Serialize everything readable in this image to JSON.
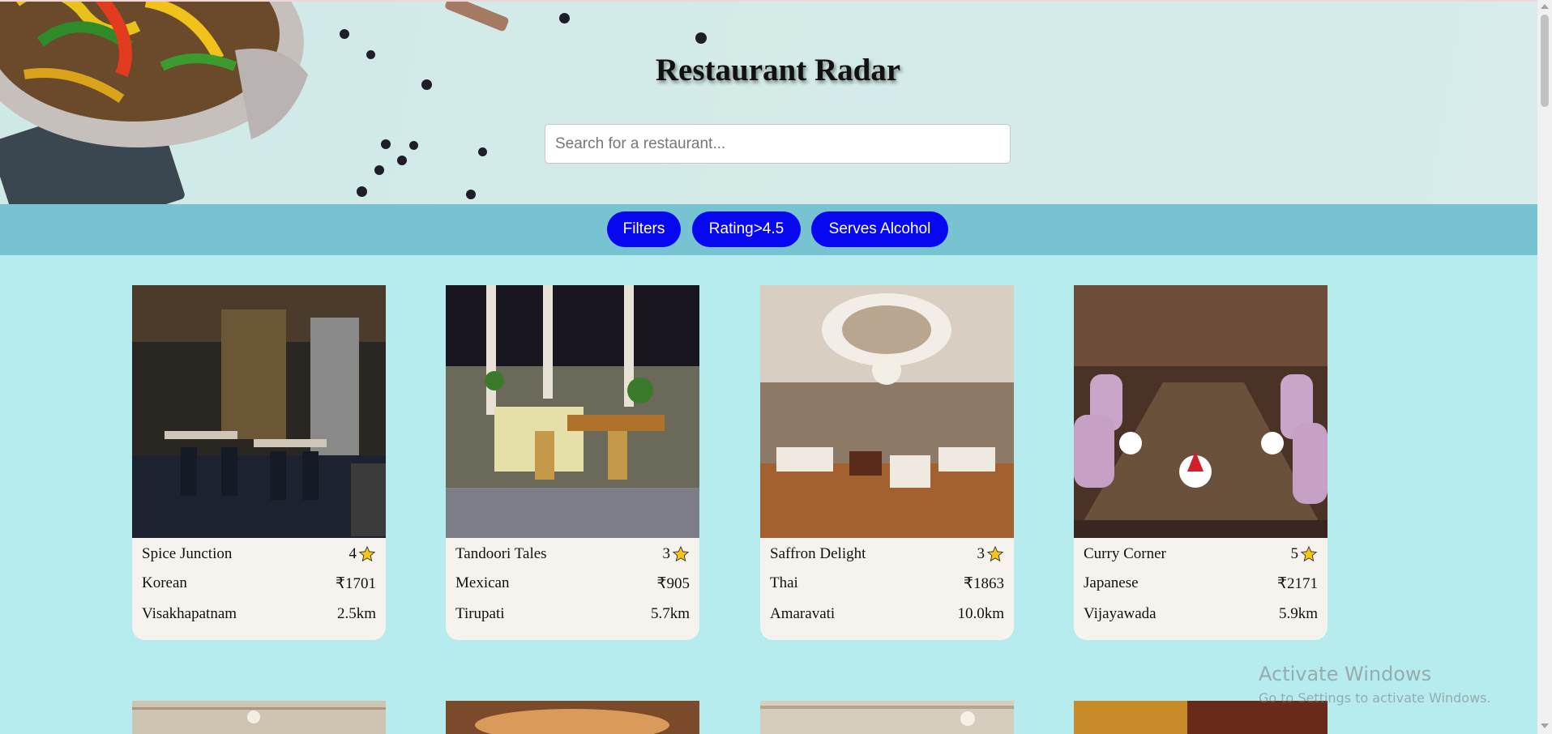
{
  "header": {
    "title": "Restaurant Radar",
    "search_placeholder": "Search for a restaurant..."
  },
  "filters": [
    {
      "label": "Filters"
    },
    {
      "label": "Rating>4.5"
    },
    {
      "label": "Serves Alcohol"
    }
  ],
  "restaurants": [
    {
      "name": "Spice Junction",
      "rating": "4",
      "cuisine": "Korean",
      "price": "₹1701",
      "city": "Visakhapatnam",
      "distance": "2.5km"
    },
    {
      "name": "Tandoori Tales",
      "rating": "3",
      "cuisine": "Mexican",
      "price": "₹905",
      "city": "Tirupati",
      "distance": "5.7km"
    },
    {
      "name": "Saffron Delight",
      "rating": "3",
      "cuisine": "Thai",
      "price": "₹1863",
      "city": "Amaravati",
      "distance": "10.0km"
    },
    {
      "name": "Curry Corner",
      "rating": "5",
      "cuisine": "Japanese",
      "price": "₹2171",
      "city": "Vijayawada",
      "distance": "5.9km"
    }
  ],
  "os_watermark": {
    "line1": "Activate Windows",
    "line2": "Go to Settings to activate Windows."
  },
  "colors": {
    "page_bg": "#b7ecef",
    "filter_bar": "#78c3d1",
    "pill": "#0707f0",
    "card_bg": "#f6f3ef",
    "star": "#f5c518"
  }
}
